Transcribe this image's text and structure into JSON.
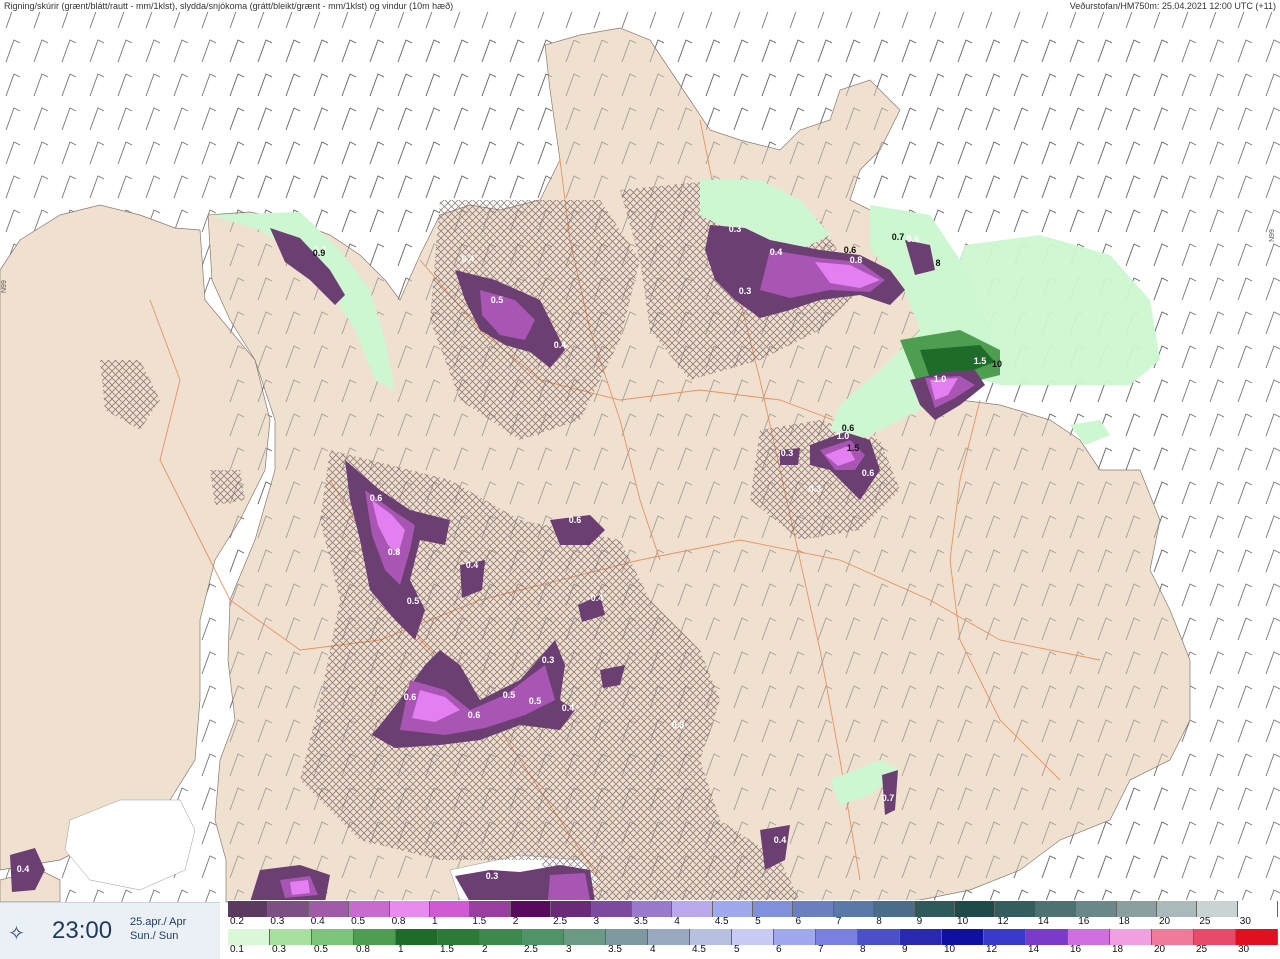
{
  "header": {
    "left": "Rigning/skúrir (grænt/blátt/rautt - mm/1klst), slydda/snjókoma (grátt/bleikt/grænt - mm/1klst) og vindur (10m hæð)",
    "right": "Veðurstofan/HM750m: 25.04.2021 12:00 UTC (+11)"
  },
  "grid_label": "N99",
  "time": {
    "icon": "weather-service-icon",
    "value": "23:00",
    "date_line1": "25.apr./ Apr",
    "date_line2": "Sun./ Sun"
  },
  "colors": {
    "land": "#f0e0d0",
    "sea": "#ffffff",
    "roads": "#e98a55",
    "snow_dark": "#6b3f72",
    "snow_mid": "#a855b3",
    "snow_light": "#e37ff0",
    "rain_light": "#ccf7d0",
    "rain_dark": "#2d6e3a"
  },
  "legend": {
    "row1": {
      "labels": [
        "0.2",
        "0.3",
        "0.4",
        "0.5",
        "0.8",
        "1",
        "1.5",
        "2",
        "2.5",
        "3",
        "3.5",
        "4",
        "4.5",
        "5",
        "6",
        "7",
        "8",
        "9",
        "10",
        "12",
        "14",
        "16",
        "18",
        "20",
        "25",
        "30"
      ],
      "colors": [
        "#5a3a5e",
        "#7e4f85",
        "#a05aa8",
        "#c86bd0",
        "#e88af0",
        "#cf5ad3",
        "#9a3da0",
        "#5a0a5e",
        "#6b2a78",
        "#7d4aa0",
        "#9a7acd",
        "#bba9ee",
        "#a0a8ee",
        "#8090dc",
        "#6a7ec0",
        "#5a78a8",
        "#4a6e8a",
        "#2f5a5c",
        "#1e4a4a",
        "#345e5e",
        "#4e7272",
        "#6a8888",
        "#8aa0a0",
        "#aababa",
        "#c8d4d4",
        "#ffffff"
      ]
    },
    "row2": {
      "labels": [
        "0.1",
        "0.3",
        "0.5",
        "0.8",
        "1",
        "1.5",
        "2",
        "2.5",
        "3",
        "3.5",
        "4",
        "4.5",
        "5",
        "6",
        "7",
        "8",
        "9",
        "10",
        "12",
        "14",
        "16",
        "18",
        "20",
        "25",
        "30"
      ],
      "colors": [
        "#d8f8d8",
        "#a8e0a0",
        "#7cc47a",
        "#4e9e52",
        "#1f6b2a",
        "#2a7a38",
        "#3c8a4e",
        "#4e9466",
        "#6a9a84",
        "#7e9aa0",
        "#9aa8c0",
        "#b8c0e0",
        "#c8ccf4",
        "#a0a8f0",
        "#7a80e0",
        "#4a50c8",
        "#2828b0",
        "#1010a0",
        "#3a3ac8",
        "#7a3cc8",
        "#d070e0",
        "#f0a0e0",
        "#f07a9a",
        "#e84a6a",
        "#e01020"
      ]
    }
  },
  "map_values": [
    {
      "text": "0.3",
      "dark": false
    },
    {
      "text": "0.4",
      "dark": false
    },
    {
      "text": "0.5",
      "dark": false
    },
    {
      "text": "0.4",
      "dark": false
    },
    {
      "text": "0.3",
      "dark": false
    },
    {
      "text": "0.4",
      "dark": false
    },
    {
      "text": "0.6",
      "dark": true
    },
    {
      "text": "0.8",
      "dark": false
    },
    {
      "text": "0.3",
      "dark": false
    },
    {
      "text": "0.7",
      "dark": true
    },
    {
      "text": "0.6",
      "dark": false
    },
    {
      "text": "8",
      "dark": true
    },
    {
      "text": "1.5",
      "dark": false
    },
    {
      "text": "1.0",
      "dark": false
    },
    {
      "text": "10",
      "dark": true
    },
    {
      "text": "0.6",
      "dark": true
    },
    {
      "text": "1.0",
      "dark": false
    },
    {
      "text": "1.5",
      "dark": true
    },
    {
      "text": "0.3",
      "dark": false
    },
    {
      "text": "0.6",
      "dark": false
    },
    {
      "text": "0.3",
      "dark": false
    },
    {
      "text": "0.6",
      "dark": false
    },
    {
      "text": "0.8",
      "dark": false
    },
    {
      "text": "0.5",
      "dark": false
    },
    {
      "text": "0.4",
      "dark": false
    },
    {
      "text": "0.6",
      "dark": false
    },
    {
      "text": "0.4",
      "dark": false
    },
    {
      "text": "0.6",
      "dark": false
    },
    {
      "text": "0.6",
      "dark": false
    },
    {
      "text": "0.5",
      "dark": false
    },
    {
      "text": "0.5",
      "dark": false
    },
    {
      "text": "0.4",
      "dark": false
    },
    {
      "text": "0.3",
      "dark": false
    },
    {
      "text": "0.7",
      "dark": false
    },
    {
      "text": "0.4",
      "dark": false
    },
    {
      "text": "0.3",
      "dark": false
    },
    {
      "text": "0.4",
      "dark": false
    },
    {
      "text": "0.3",
      "dark": false
    },
    {
      "text": "0.9",
      "dark": true
    }
  ]
}
